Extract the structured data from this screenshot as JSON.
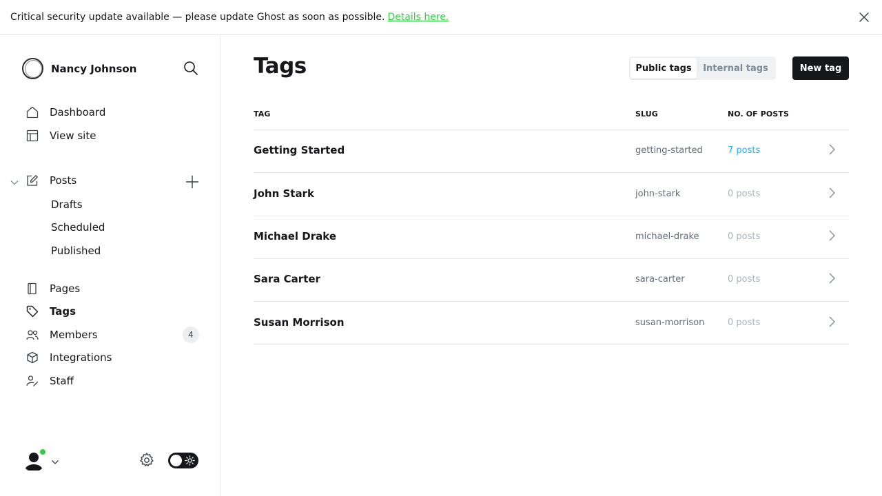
{
  "banner": {
    "message": "Critical security update available — please update Ghost as soon as possible.",
    "link_text": "Details here."
  },
  "sidebar": {
    "site_name": "Nancy Johnson",
    "nav_top": [
      {
        "label": "Dashboard",
        "icon": "home-icon"
      },
      {
        "label": "View site",
        "icon": "layout-icon"
      }
    ],
    "posts": {
      "label": "Posts",
      "sub_items": [
        "Drafts",
        "Scheduled",
        "Published"
      ]
    },
    "nav_bottom": [
      {
        "label": "Pages",
        "icon": "pages-icon"
      },
      {
        "label": "Tags",
        "icon": "tag-icon"
      },
      {
        "label": "Members",
        "icon": "members-icon"
      },
      {
        "label": "Integrations",
        "icon": "box-icon"
      },
      {
        "label": "Staff",
        "icon": "staff-icon"
      }
    ],
    "members_count": "4"
  },
  "main": {
    "title": "Tags",
    "tabs": [
      {
        "label": "Public tags",
        "active": true
      },
      {
        "label": "Internal tags",
        "active": false
      }
    ],
    "new_button": "New tag",
    "columns": [
      "TAG",
      "SLUG",
      "NO. OF POSTS"
    ],
    "rows": [
      {
        "name": "Getting Started",
        "slug": "getting-started",
        "posts": "7 posts"
      },
      {
        "name": "John Stark",
        "slug": "john-stark",
        "posts": "0 posts"
      },
      {
        "name": "Michael Drake",
        "slug": "michael-drake",
        "posts": "0 posts"
      },
      {
        "name": "Sara Carter",
        "slug": "sara-carter",
        "posts": "0 posts"
      },
      {
        "name": "Susan Morrison",
        "slug": "susan-morrison",
        "posts": "0 posts"
      }
    ]
  },
  "colors": {
    "accent_green": "#30cf43",
    "link_blue": "#14b8ff",
    "dark": "#15171a"
  }
}
